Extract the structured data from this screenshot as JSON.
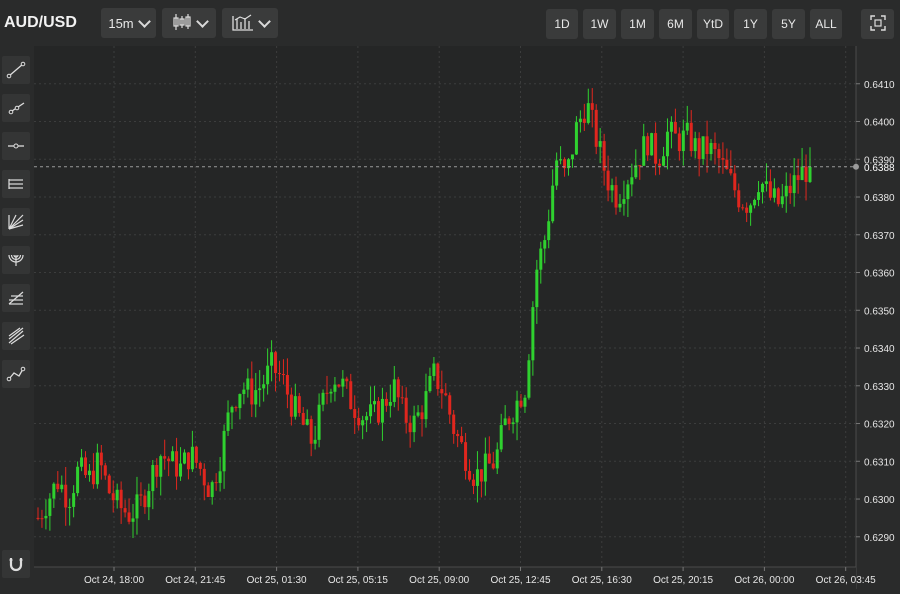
{
  "header": {
    "symbol": "AUD/USD",
    "interval": "15m",
    "chart_type_icon": "candlestick-icon",
    "indicators_icon": "indicators-icon",
    "fullscreen_icon": "fullscreen-icon",
    "ranges": [
      "1D",
      "1W",
      "1M",
      "6M",
      "YtD",
      "1Y",
      "5Y",
      "ALL"
    ]
  },
  "sidebar": {
    "tools": [
      "trend-line-icon",
      "ray-icon",
      "horizontal-line-icon",
      "parallel-channel-icon",
      "fib-fan-icon",
      "fib-arcs-icon",
      "fib-retracement-icon",
      "pitchfork-icon",
      "path-icon"
    ],
    "bottom_tool": "magnet-icon"
  },
  "colors": {
    "up": "#2fd12f",
    "down": "#e0261e",
    "grid": "#3c3d3d",
    "background": "#2a2b2b"
  },
  "chart_data": {
    "type": "candlestick",
    "interval": "15m",
    "x_ticks": [
      "Oct 24, 18:00",
      "Oct 24, 21:45",
      "Oct 25, 01:30",
      "Oct 25, 05:15",
      "Oct 25, 09:00",
      "Oct 25, 12:45",
      "Oct 25, 16:30",
      "Oct 25, 20:15",
      "Oct 26, 00:00",
      "Oct 26, 03:45"
    ],
    "y_ticks": [
      "0.6410",
      "0.6400",
      "0.6390",
      "0.6380",
      "0.6370",
      "0.6360",
      "0.6350",
      "0.6340",
      "0.6330",
      "0.6320",
      "0.6310",
      "0.6300",
      "0.6290"
    ],
    "ylim": [
      0.6282,
      0.642
    ],
    "last_price": "0.6388",
    "last_price_value": 0.6388,
    "close_path": [
      0.6295,
      0.63,
      0.6305,
      0.63,
      0.6308,
      0.6305,
      0.631,
      0.6302,
      0.6298,
      0.6296,
      0.6298,
      0.6305,
      0.6312,
      0.631,
      0.6308,
      0.6312,
      0.6308,
      0.6302,
      0.6312,
      0.6325,
      0.633,
      0.6328,
      0.633,
      0.6335,
      0.6332,
      0.6325,
      0.632,
      0.6315,
      0.6325,
      0.6333,
      0.633,
      0.6325,
      0.6322,
      0.6322,
      0.6325,
      0.633,
      0.6322,
      0.632,
      0.6325,
      0.6333,
      0.6328,
      0.6318,
      0.6312,
      0.6306,
      0.6308,
      0.631,
      0.632,
      0.6325,
      0.633,
      0.636,
      0.637,
      0.639,
      0.6385,
      0.6398,
      0.6405,
      0.6395,
      0.6385,
      0.638,
      0.6385,
      0.639,
      0.6395,
      0.639,
      0.6397,
      0.6395,
      0.6396,
      0.6392,
      0.6393,
      0.639,
      0.6385,
      0.638,
      0.6378,
      0.6385,
      0.638,
      0.6378,
      0.6382,
      0.6386,
      0.6388
    ]
  }
}
